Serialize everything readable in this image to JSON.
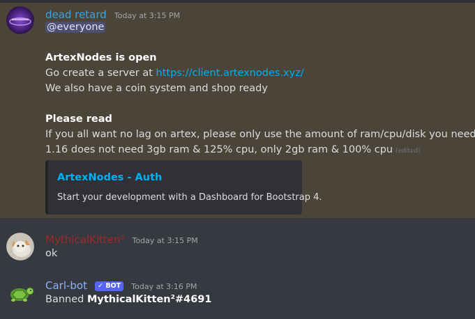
{
  "messages": [
    {
      "author": "dead retard",
      "author_color": "#3ba4e3",
      "timestamp": "Today at 3:15 PM",
      "mention": "@everyone",
      "heading1": "ArtexNodes is open",
      "line_prefix": "Go create a server at ",
      "link": "https://client.artexnodes.xyz/",
      "line3": "We also have a coin system and shop ready",
      "heading2": "Please read",
      "line4": "If you all want no lag on artex, please only use the amount of ram/cpu/disk you need",
      "line5": "1.16 does not need 3gb ram & 125% cpu, only 2gb ram & 100% cpu",
      "edited": "(edited)",
      "embed": {
        "title": "ArtexNodes - Auth",
        "description": "Start your development with a Dashboard for Bootstrap 4."
      }
    },
    {
      "author": "MythicalKitten²",
      "author_color": "#9c2a2a",
      "timestamp": "Today at 3:15 PM",
      "text": "ok"
    },
    {
      "author": "Carl-bot",
      "author_color": "#8ab4f8",
      "badge": "✓ BOT",
      "timestamp": "Today at 3:16 PM",
      "text_prefix": "Banned ",
      "text_bold": "MythicalKitten²#4691"
    }
  ]
}
